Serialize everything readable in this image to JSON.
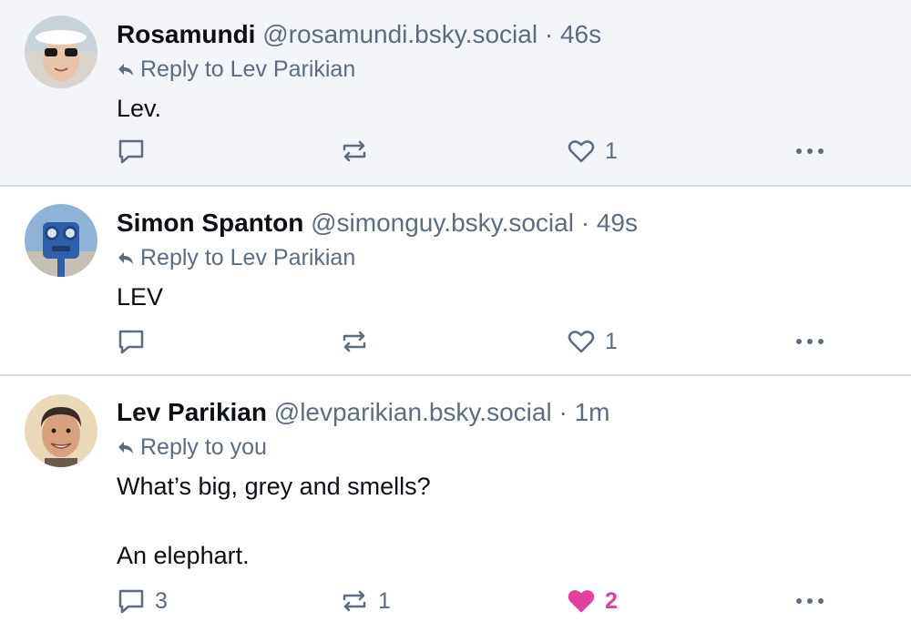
{
  "posts": [
    {
      "author": "Rosamundi",
      "handle": "@rosamundi.bsky.social",
      "separator": "·",
      "time": "46s",
      "reply_to": "Reply to Lev Parikian",
      "text": "Lev.",
      "reply_count": "",
      "repost_count": "",
      "like_count": "1",
      "liked": false
    },
    {
      "author": "Simon Spanton",
      "handle": "@simonguy.bsky.social",
      "separator": "·",
      "time": "49s",
      "reply_to": "Reply to Lev Parikian",
      "text": "LEV",
      "reply_count": "",
      "repost_count": "",
      "like_count": "1",
      "liked": false
    },
    {
      "author": "Lev Parikian",
      "handle": "@levparikian.bsky.social",
      "separator": "·",
      "time": "1m",
      "reply_to": "Reply to you",
      "text": "What’s big, grey and smells?\n\nAn elephart.",
      "reply_count": "3",
      "repost_count": "1",
      "like_count": "2",
      "liked": true
    }
  ],
  "colors": {
    "muted": "#5c6d82",
    "like_active": "#e2409c",
    "selected_bg": "#f3f5f8",
    "divider": "#d8dde2"
  },
  "icons": [
    "reply-arrow-icon",
    "comment-icon",
    "repost-icon",
    "heart-icon",
    "more-icon"
  ]
}
